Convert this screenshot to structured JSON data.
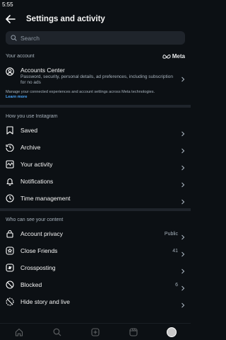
{
  "status": {
    "time": "5:55"
  },
  "header": {
    "title": "Settings and activity"
  },
  "search": {
    "placeholder": "Search"
  },
  "account": {
    "section_label": "Your account",
    "brand": "Meta",
    "accounts_center": {
      "title": "Accounts Center",
      "subtitle": "Password, security, personal details, ad preferences, including subscription for no ads"
    },
    "manage_text": "Manage your connected experiences and account settings across Meta technologies.",
    "learn_more": "Learn more"
  },
  "how_you_use": {
    "section_label": "How you use Instagram",
    "items": [
      {
        "label": "Saved",
        "icon": "bookmark-icon"
      },
      {
        "label": "Archive",
        "icon": "archive-icon"
      },
      {
        "label": "Your activity",
        "icon": "activity-icon"
      },
      {
        "label": "Notifications",
        "icon": "bell-icon"
      },
      {
        "label": "Time management",
        "icon": "clock-icon"
      }
    ]
  },
  "who_can_see": {
    "section_label": "Who can see your content",
    "items": [
      {
        "label": "Account privacy",
        "value": "Public",
        "icon": "lock-icon"
      },
      {
        "label": "Close Friends",
        "value": "41",
        "icon": "star-icon"
      },
      {
        "label": "Crossposting",
        "value": "",
        "icon": "crosspost-icon"
      },
      {
        "label": "Blocked",
        "value": "6",
        "icon": "blocked-icon"
      },
      {
        "label": "Hide story and live",
        "value": "",
        "icon": "hide-story-icon"
      }
    ]
  },
  "bottom_nav": [
    "home-icon",
    "search-icon",
    "create-icon",
    "reels-icon",
    "profile-avatar"
  ]
}
